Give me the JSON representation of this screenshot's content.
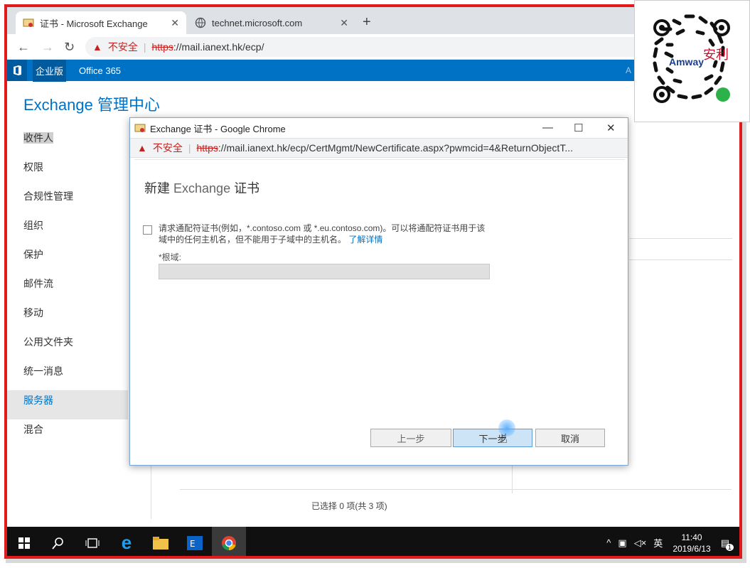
{
  "browser": {
    "tabs": [
      {
        "label": "证书 - Microsoft Exchange",
        "active": true
      },
      {
        "label": "technet.microsoft.com",
        "active": false
      }
    ],
    "newtab_glyph": "+",
    "not_secure": "不安全",
    "url_scheme": "https",
    "url_rest": "://mail.ianext.hk/ecp/"
  },
  "o365": {
    "items": [
      "企业版",
      "Office 365"
    ],
    "right_letter": "A"
  },
  "eac": {
    "title": "Exchange 管理中心",
    "nav": [
      "收件人",
      "权限",
      "合规性管理",
      "组织",
      "保护",
      "邮件流",
      "移动",
      "公用文件夹",
      "统一消息",
      "服务器",
      "混合"
    ],
    "selected_index": 9,
    "status": "已选择 0 项(共 3 项)"
  },
  "popup": {
    "title": "Exchange 证书 - Google Chrome",
    "not_secure": "不安全",
    "url_scheme": "https",
    "url_rest": "://mail.ianext.hk/ecp/CertMgmt/NewCertificate.aspx?pwmcid=4&ReturnObjectT...",
    "heading_prefix": "新建",
    "heading_mid": "Exchange",
    "heading_suffix": "证书",
    "wildcard_text": "请求通配符证书(例如，*.contoso.com 或 *.eu.contoso.com)。可以将通配符证书用于该域中的任何主机名，但不能用于子域中的主机名。",
    "learn_more": "了解详情",
    "root_label": "*根域:",
    "back": "上一步",
    "next": "下一步",
    "cancel": "取消"
  },
  "taskbar": {
    "time": "11:40",
    "date": "2019/6/13",
    "lang": "英",
    "notif_count": "1"
  },
  "qr": {
    "brand": "Amway",
    "brand_cn": "安利"
  },
  "colors": {
    "frame_red": "#e11b1b",
    "office_blue": "#0072c6"
  }
}
